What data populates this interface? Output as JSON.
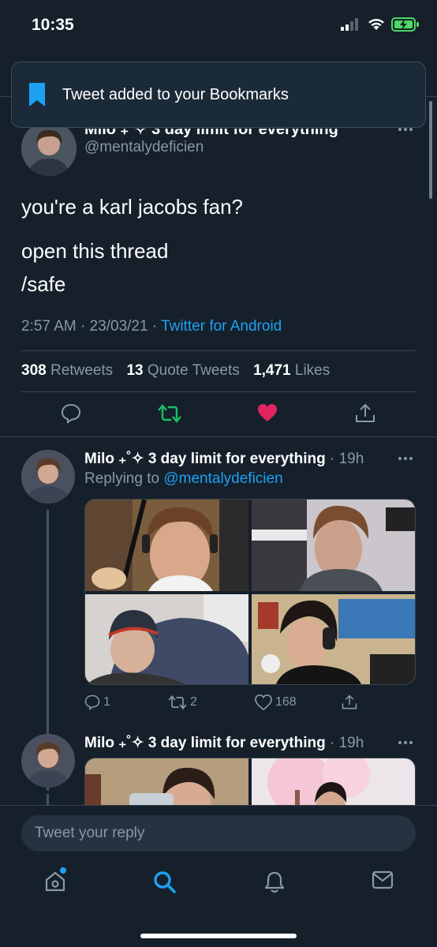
{
  "status": {
    "time": "10:35"
  },
  "toast": {
    "text": "Tweet added to your Bookmarks"
  },
  "main_tweet": {
    "name": "Milo ₊˚✧ 3 day limit for everything",
    "handle": "@mentalydeficien",
    "body": [
      "you're a karl jacobs fan?",
      "open this thread",
      "/safe"
    ],
    "time": "2:57 AM · 23/03/21 · ",
    "source": "Twitter for Android",
    "retweets_count": "308",
    "retweets_label": "Retweets",
    "quotes_count": "13",
    "quotes_label": "Quote Tweets",
    "likes_count": "1,471",
    "likes_label": "Likes"
  },
  "replies": [
    {
      "name": "Milo ₊˚✧ 3 day limit for everything",
      "time": "· 19h",
      "replying_prefix": "Replying to ",
      "replying_to": "@mentalydeficien",
      "reply_count": "1",
      "retweet_count": "2",
      "like_count": "168"
    },
    {
      "name": "Milo ₊˚✧ 3 day limit for everything",
      "time": "· 19h"
    }
  ],
  "reply_bar": {
    "placeholder": "Tweet your reply"
  },
  "colors": {
    "accent": "#1da1f2",
    "like": "#e0245e",
    "retweet": "#17bf63",
    "bg": "#15202b",
    "muted": "#8899a6"
  },
  "icons": [
    "bookmark-icon",
    "reply-icon",
    "retweet-icon",
    "like-icon",
    "share-icon",
    "home-icon",
    "search-icon",
    "notifications-icon",
    "messages-icon",
    "more-icon"
  ]
}
